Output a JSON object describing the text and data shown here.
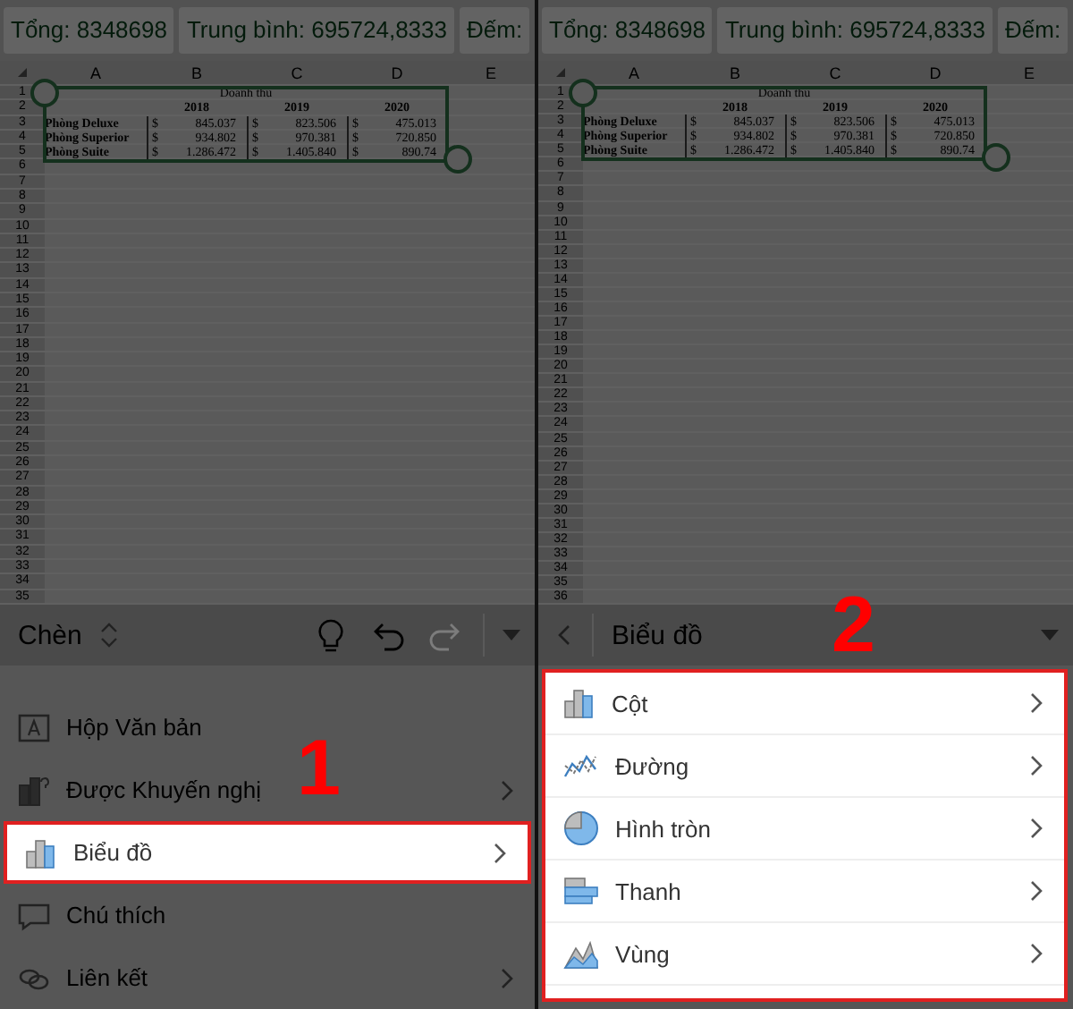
{
  "panels": [
    {
      "status_chips": [
        "Tổng: 8348698",
        "Trung bình: 695724,8333",
        "Đếm:"
      ],
      "sheet": {
        "column_headers": [
          "A",
          "B",
          "C",
          "D",
          "E"
        ],
        "row_numbers": [
          "1",
          "2",
          "3",
          "4",
          "5",
          "6",
          "7",
          "8",
          "9",
          "10",
          "11",
          "12",
          "13",
          "14",
          "15",
          "16",
          "17",
          "18",
          "19",
          "20",
          "21",
          "22",
          "23",
          "24",
          "25",
          "26",
          "27",
          "28",
          "29",
          "30",
          "31",
          "32",
          "33",
          "34",
          "35"
        ],
        "table": {
          "title": "Doanh thu",
          "years": [
            "2018",
            "2019",
            "2020"
          ],
          "rows": [
            {
              "label": "Phòng Deluxe",
              "values": [
                {
                  "currency": "$",
                  "amount": "845.037"
                },
                {
                  "currency": "$",
                  "amount": "823.506"
                },
                {
                  "currency": "$",
                  "amount": "475.013"
                }
              ]
            },
            {
              "label": "Phòng Superior",
              "values": [
                {
                  "currency": "$",
                  "amount": "934.802"
                },
                {
                  "currency": "$",
                  "amount": "970.381"
                },
                {
                  "currency": "$",
                  "amount": "720.850"
                }
              ]
            },
            {
              "label": "Phòng Suite",
              "values": [
                {
                  "currency": "$",
                  "amount": "1.286.472"
                },
                {
                  "currency": "$",
                  "amount": "1.405.840"
                },
                {
                  "currency": "$",
                  "amount": "890.74"
                }
              ]
            }
          ]
        }
      },
      "toolbar": {
        "kind": "insert",
        "title": "Chèn",
        "actions": [
          {
            "kind": "idea",
            "disabled": false
          },
          {
            "kind": "undo",
            "disabled": false
          },
          {
            "kind": "redo",
            "disabled": true
          }
        ]
      },
      "menu": {
        "highlighted": false,
        "items": [
          {
            "kind": "textbox",
            "label": "Hộp Văn bản",
            "has_submenu": false,
            "selected": false
          },
          {
            "kind": "recommended",
            "label": "Được Khuyến nghị",
            "has_submenu": true,
            "selected": false
          },
          {
            "kind": "column",
            "label": "Biểu đồ",
            "has_submenu": true,
            "selected": true
          },
          {
            "kind": "comment",
            "label": "Chú thích",
            "has_submenu": false,
            "selected": false
          },
          {
            "kind": "link",
            "label": "Liên kết",
            "has_submenu": true,
            "selected": false
          }
        ]
      },
      "step_label": "1"
    },
    {
      "status_chips": [
        "Tổng: 8348698",
        "Trung bình: 695724,8333",
        "Đếm:"
      ],
      "sheet": {
        "column_headers": [
          "A",
          "B",
          "C",
          "D",
          "E"
        ],
        "row_numbers": [
          "1",
          "2",
          "3",
          "4",
          "5",
          "6",
          "7",
          "8",
          "9",
          "10",
          "11",
          "12",
          "13",
          "14",
          "15",
          "16",
          "17",
          "18",
          "19",
          "20",
          "21",
          "22",
          "23",
          "24",
          "25",
          "26",
          "27",
          "28",
          "29",
          "30",
          "31",
          "32",
          "33",
          "34",
          "35",
          "36"
        ],
        "table": {
          "title": "Doanh thu",
          "years": [
            "2018",
            "2019",
            "2020"
          ],
          "rows": [
            {
              "label": "Phòng Deluxe",
              "values": [
                {
                  "currency": "$",
                  "amount": "845.037"
                },
                {
                  "currency": "$",
                  "amount": "823.506"
                },
                {
                  "currency": "$",
                  "amount": "475.013"
                }
              ]
            },
            {
              "label": "Phòng Superior",
              "values": [
                {
                  "currency": "$",
                  "amount": "934.802"
                },
                {
                  "currency": "$",
                  "amount": "970.381"
                },
                {
                  "currency": "$",
                  "amount": "720.850"
                }
              ]
            },
            {
              "label": "Phòng Suite",
              "values": [
                {
                  "currency": "$",
                  "amount": "1.286.472"
                },
                {
                  "currency": "$",
                  "amount": "1.405.840"
                },
                {
                  "currency": "$",
                  "amount": "890.74"
                }
              ]
            }
          ]
        }
      },
      "toolbar": {
        "kind": "submenu",
        "title": "Biểu đồ"
      },
      "menu": {
        "highlighted": true,
        "items": [
          {
            "kind": "column",
            "label": "Cột",
            "has_submenu": true,
            "selected": false
          },
          {
            "kind": "line",
            "label": "Đường",
            "has_submenu": true,
            "selected": false
          },
          {
            "kind": "pie",
            "label": "Hình tròn",
            "has_submenu": true,
            "selected": false
          },
          {
            "kind": "bar",
            "label": "Thanh",
            "has_submenu": true,
            "selected": false
          },
          {
            "kind": "area",
            "label": "Vùng",
            "has_submenu": true,
            "selected": false
          }
        ]
      },
      "step_label": "2"
    }
  ]
}
